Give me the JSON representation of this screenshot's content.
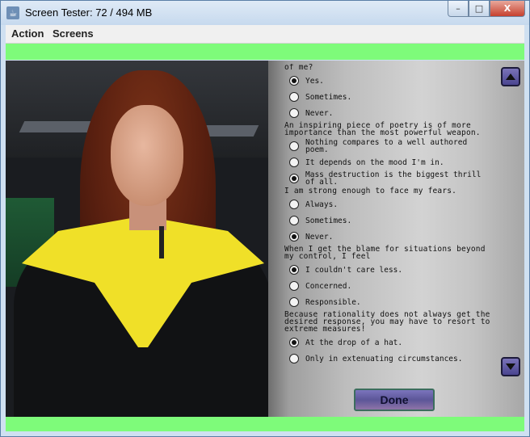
{
  "window": {
    "title": "Screen Tester: 72 / 494 MB",
    "minimize": "–",
    "maximize": "□",
    "close": "X"
  },
  "menu": {
    "items": [
      "Action",
      "Screens"
    ]
  },
  "questionnaire": {
    "items": [
      {
        "question": "of me?",
        "options": [
          {
            "label": "Yes.",
            "selected": true
          },
          {
            "label": "Sometimes.",
            "selected": false
          },
          {
            "label": "Never.",
            "selected": false
          }
        ]
      },
      {
        "question": "An inspiring piece of poetry is of more importance than the most powerful weapon.",
        "options": [
          {
            "label": "Nothing compares to a well authored poem.",
            "selected": false
          },
          {
            "label": "It depends on the mood I'm in.",
            "selected": false
          },
          {
            "label": "Mass destruction is the biggest thrill of all.",
            "selected": true
          }
        ]
      },
      {
        "question": "I am strong enough to face my fears.",
        "options": [
          {
            "label": "Always.",
            "selected": false
          },
          {
            "label": "Sometimes.",
            "selected": false
          },
          {
            "label": "Never.",
            "selected": true
          }
        ]
      },
      {
        "question": "When I get the blame for situations beyond my control, I feel",
        "options": [
          {
            "label": "I couldn't care less.",
            "selected": true
          },
          {
            "label": "Concerned.",
            "selected": false
          },
          {
            "label": "Responsible.",
            "selected": false
          }
        ]
      },
      {
        "question": "Because rationality does not always get the desired response, you may have to resort to extreme measures!",
        "options": [
          {
            "label": "At the drop of a hat.",
            "selected": true
          },
          {
            "label": "Only in extenuating circumstances.",
            "selected": false
          }
        ]
      }
    ]
  },
  "done_label": "Done",
  "colors": {
    "green_bar": "#7efb7a",
    "button": "#5c5698"
  }
}
